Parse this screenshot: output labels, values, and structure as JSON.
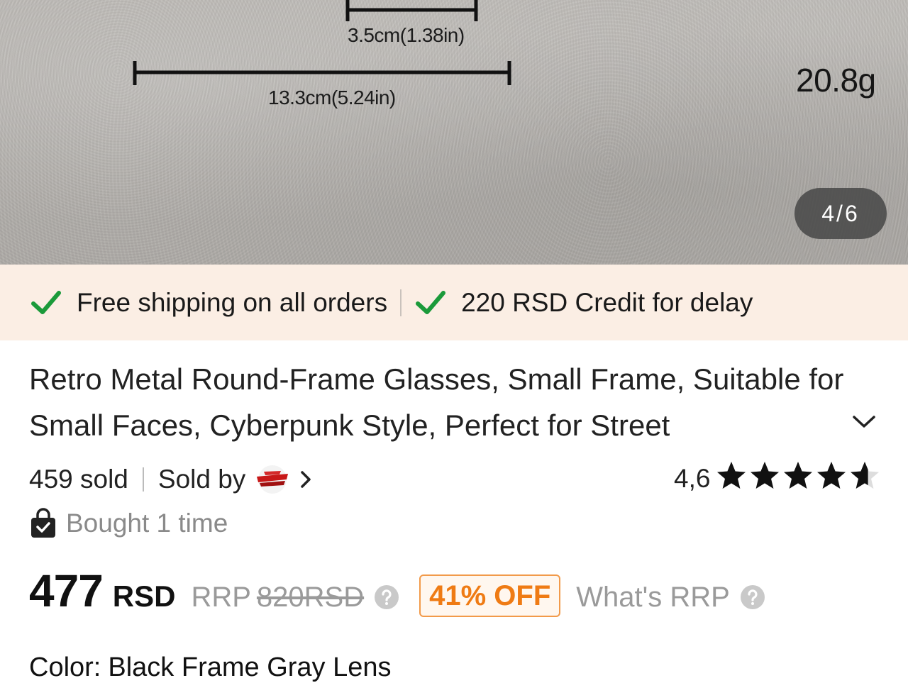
{
  "gallery": {
    "dimension_lens_height": "3.5cm(1.38in)",
    "dimension_frame_width": "13.3cm(5.24in)",
    "weight": "20.8g",
    "page_counter": "4/6"
  },
  "shipping_banner": {
    "free_shipping": "Free shipping on all orders",
    "credit_for_delay": "220 RSD Credit for delay",
    "check_color": "#1b9a3a"
  },
  "product": {
    "title": "Retro Metal Round-Frame Glasses, Small Frame, Suitable for Small Faces, Cyberpunk Style, Perfect for Street",
    "sold_count": "459 sold",
    "sold_by_label": "Sold by",
    "rating_value": "4,6",
    "rating_stars": 4.6,
    "bought_text": "Bought 1 time"
  },
  "price": {
    "amount": "477",
    "currency": "RSD",
    "rrp_label": "RRP",
    "rrp_value": "820RSD",
    "discount": "41% OFF",
    "whats_rrp": "What's RRP",
    "discount_color": "#ef7b14"
  },
  "variant": {
    "color_label": "Color:",
    "color_value": "Black Frame Gray Lens"
  },
  "icons": {
    "check": "check-icon",
    "chevron_down": "chevron-down-icon",
    "chevron_right": "chevron-right-icon",
    "star": "star-icon",
    "bag": "shopping-bag-icon",
    "help": "help-circle-icon"
  }
}
